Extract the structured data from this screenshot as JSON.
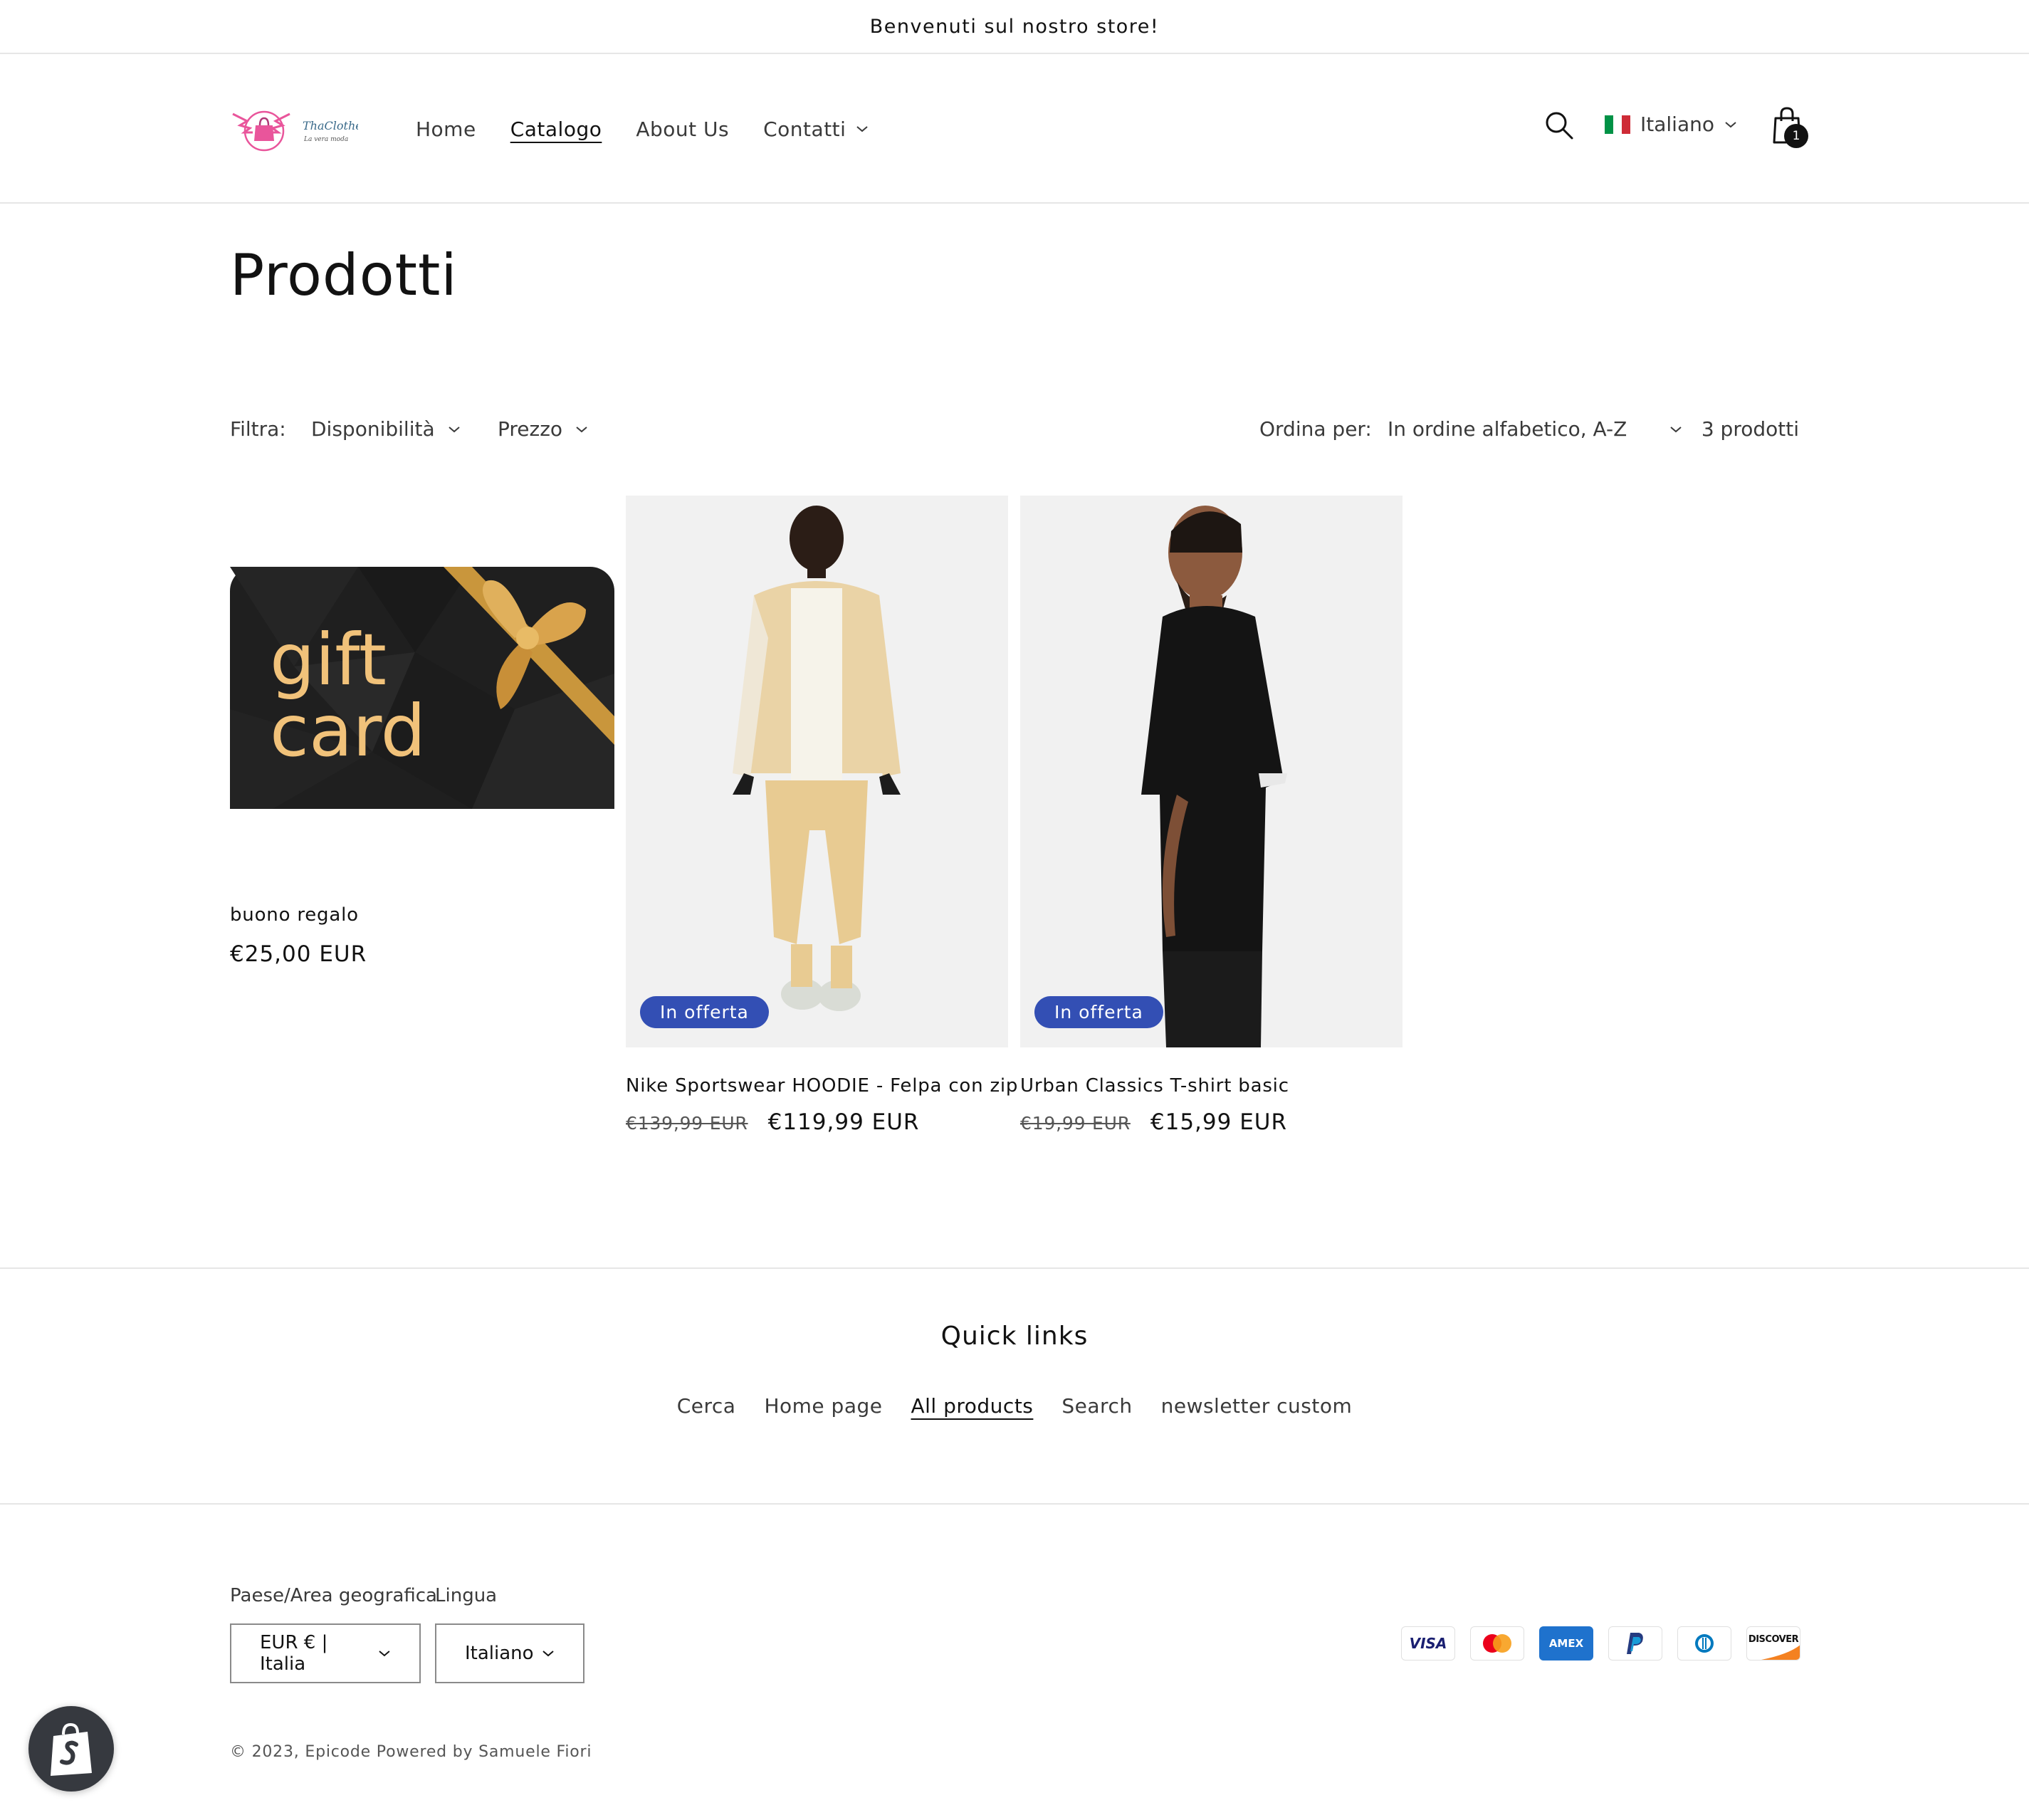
{
  "announcement": "Benvenuti sul nostro store!",
  "header": {
    "logo_name": "ThaClothes",
    "logo_tagline": "La vera moda",
    "nav": [
      {
        "label": "Home"
      },
      {
        "label": "Catalogo"
      },
      {
        "label": "About Us"
      },
      {
        "label": "Contatti"
      }
    ],
    "language": "Italiano",
    "cart_count": "1"
  },
  "page": {
    "title": "Prodotti"
  },
  "filters": {
    "label": "Filtra:",
    "availability": "Disponibilità",
    "price": "Prezzo",
    "sort_label": "Ordina per:",
    "sort_value": "In ordine alfabetico, A-Z",
    "count": "3 prodotti"
  },
  "products": [
    {
      "name": "buono regalo",
      "price": "€25,00 EUR",
      "image_text_1": "gift",
      "image_text_2": "card"
    },
    {
      "name": "Nike Sportswear HOODIE - Felpa con zip",
      "old_price": "€139,99 EUR",
      "price": "€119,99 EUR",
      "badge": "In offerta"
    },
    {
      "name": "Urban Classics T-shirt basic",
      "old_price": "€19,99 EUR",
      "price": "€15,99 EUR",
      "badge": "In offerta"
    }
  ],
  "footer": {
    "heading": "Quick links",
    "links": [
      {
        "label": "Cerca"
      },
      {
        "label": "Home page"
      },
      {
        "label": "All products"
      },
      {
        "label": "Search"
      },
      {
        "label": "newsletter custom"
      }
    ],
    "country_label": "Paese/Area geografica",
    "country_value": "EUR € | Italia",
    "language_label": "Lingua",
    "language_value": "Italiano",
    "payments": [
      "VISA",
      "AMEX",
      "DISCOVER"
    ],
    "copyright": "© 2023, Epicode Powered by Samuele Fiori"
  },
  "colors": {
    "badge": "#334fb4",
    "text": "#121212",
    "gift_card_bg": "#1f1f1f",
    "gold": "#f1c27a"
  }
}
